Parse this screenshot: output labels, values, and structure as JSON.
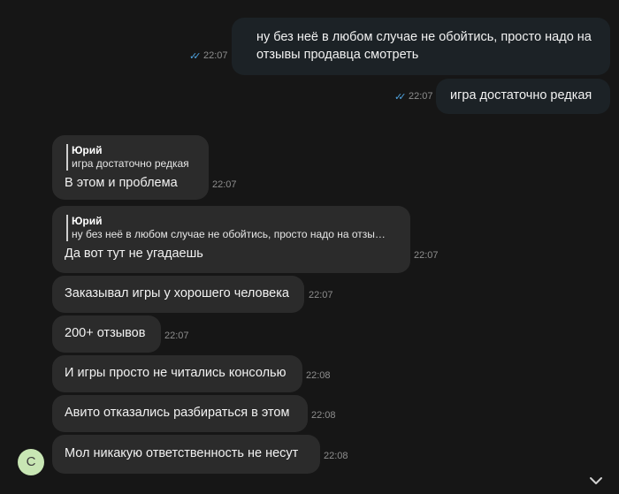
{
  "outgoing": [
    {
      "text_lines": [
        "ну без неё в любом случае не обойтись, просто надо на",
        "отзывы продавца смотреть"
      ],
      "time": "22:07",
      "read": true
    },
    {
      "text_lines": [
        "игра достаточно редкая"
      ],
      "time": "22:07",
      "read": true
    }
  ],
  "incoming": [
    {
      "reply_name": "Юрий",
      "reply_text": "игра достаточно редкая",
      "text": "В этом и проблема",
      "time": "22:07"
    },
    {
      "reply_name": "Юрий",
      "reply_text": "ну без неё в любом случае не обойтись, просто надо на отзы…",
      "text": "Да вот тут не угадаешь",
      "time": "22:07"
    },
    {
      "text": "Заказывал игры у хорошего человека",
      "time": "22:07"
    },
    {
      "text": "200+ отзывов",
      "time": "22:07"
    },
    {
      "text": "И игры просто не читались консолью",
      "time": "22:08"
    },
    {
      "text": "Авито отказались разбираться в этом",
      "time": "22:08"
    },
    {
      "text": "Мол никакую ответственность не несут",
      "time": "22:08"
    }
  ],
  "avatar_letter": "С",
  "colors": {
    "read_check": "#4fa3e0",
    "avatar_bg": "#c8e6b4"
  }
}
